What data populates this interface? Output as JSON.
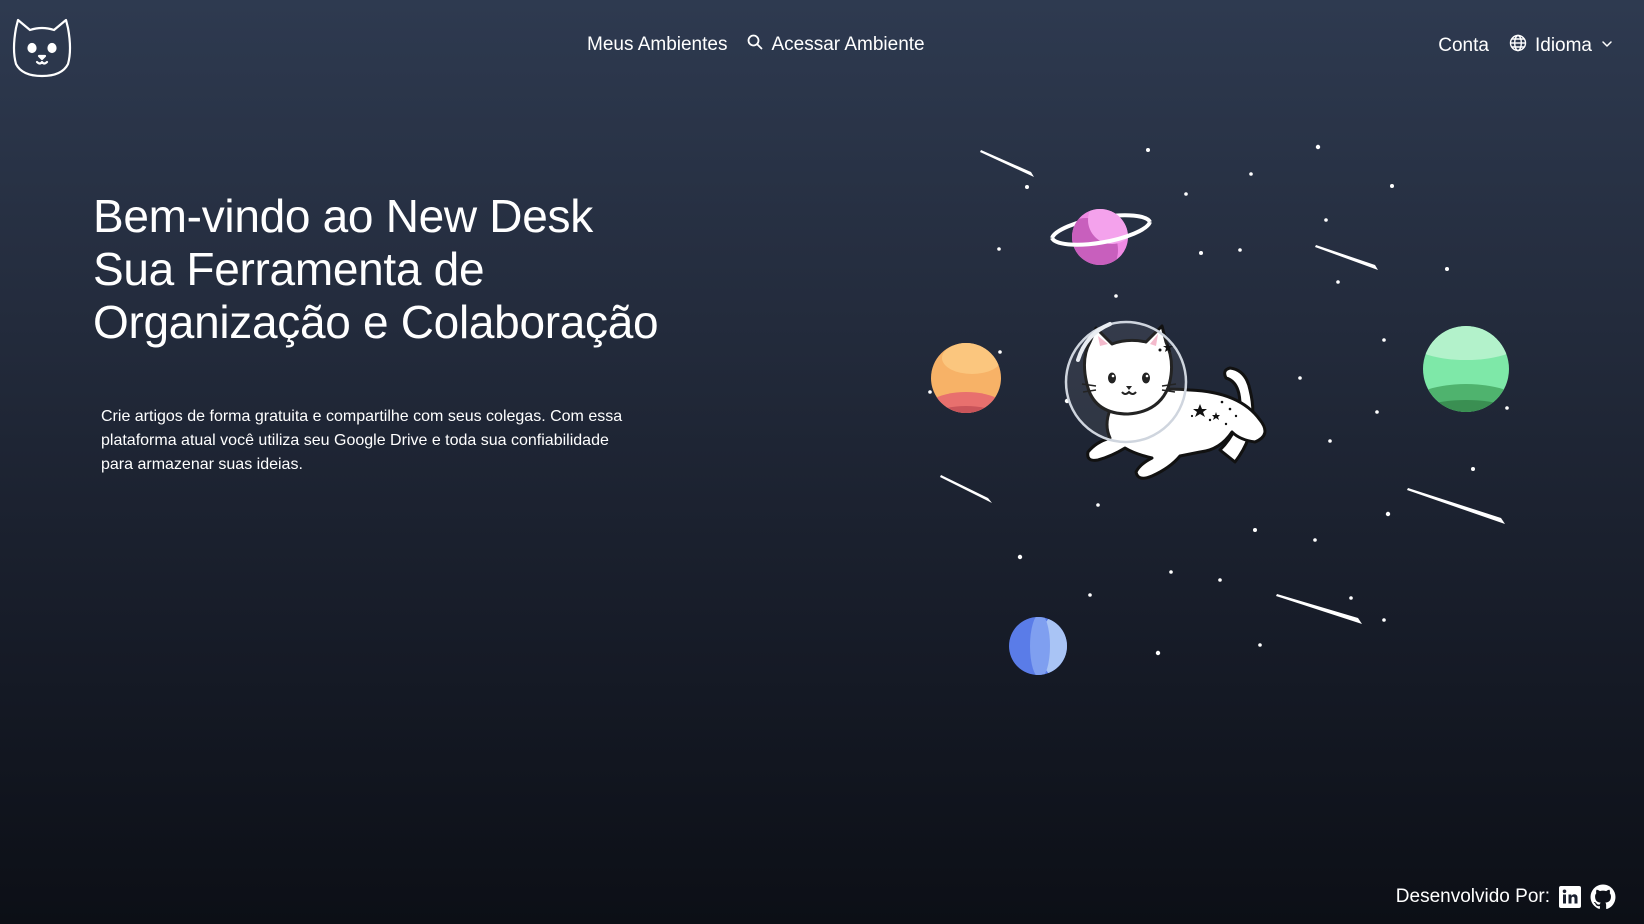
{
  "header": {
    "logo_icon": "cat-face-icon",
    "nav": {
      "my_environments": "Meus Ambientes",
      "access_environment": "Acessar Ambiente",
      "access_icon": "search-icon"
    },
    "account": "Conta",
    "language": {
      "label": "Idioma",
      "icon": "globe-icon",
      "dropdown_icon": "chevron-down-icon"
    }
  },
  "hero": {
    "title_lines": [
      "Bem-vindo ao New Desk",
      "Sua Ferramenta de",
      "Organização e Colaboração"
    ],
    "description": "Crie artigos de forma gratuita e compartilhe com seus colegas. Com essa plataforma atual você utiliza seu Google Drive e toda sua confiabilidade para armazenar suas ideias.",
    "illustration": "astronaut-cat-in-space"
  },
  "footer": {
    "developed_by": "Desenvolvido Por:",
    "linkedin_icon": "linkedin-icon",
    "github_icon": "github-icon"
  },
  "colors": {
    "background_top": "#2e3a50",
    "background_bottom": "#0c0f16",
    "text": "#ffffff",
    "planet_pink": "#e66fd8",
    "planet_orange": "#f7b267",
    "planet_green": "#7ee8a8",
    "planet_blue": "#6d8ff0"
  }
}
